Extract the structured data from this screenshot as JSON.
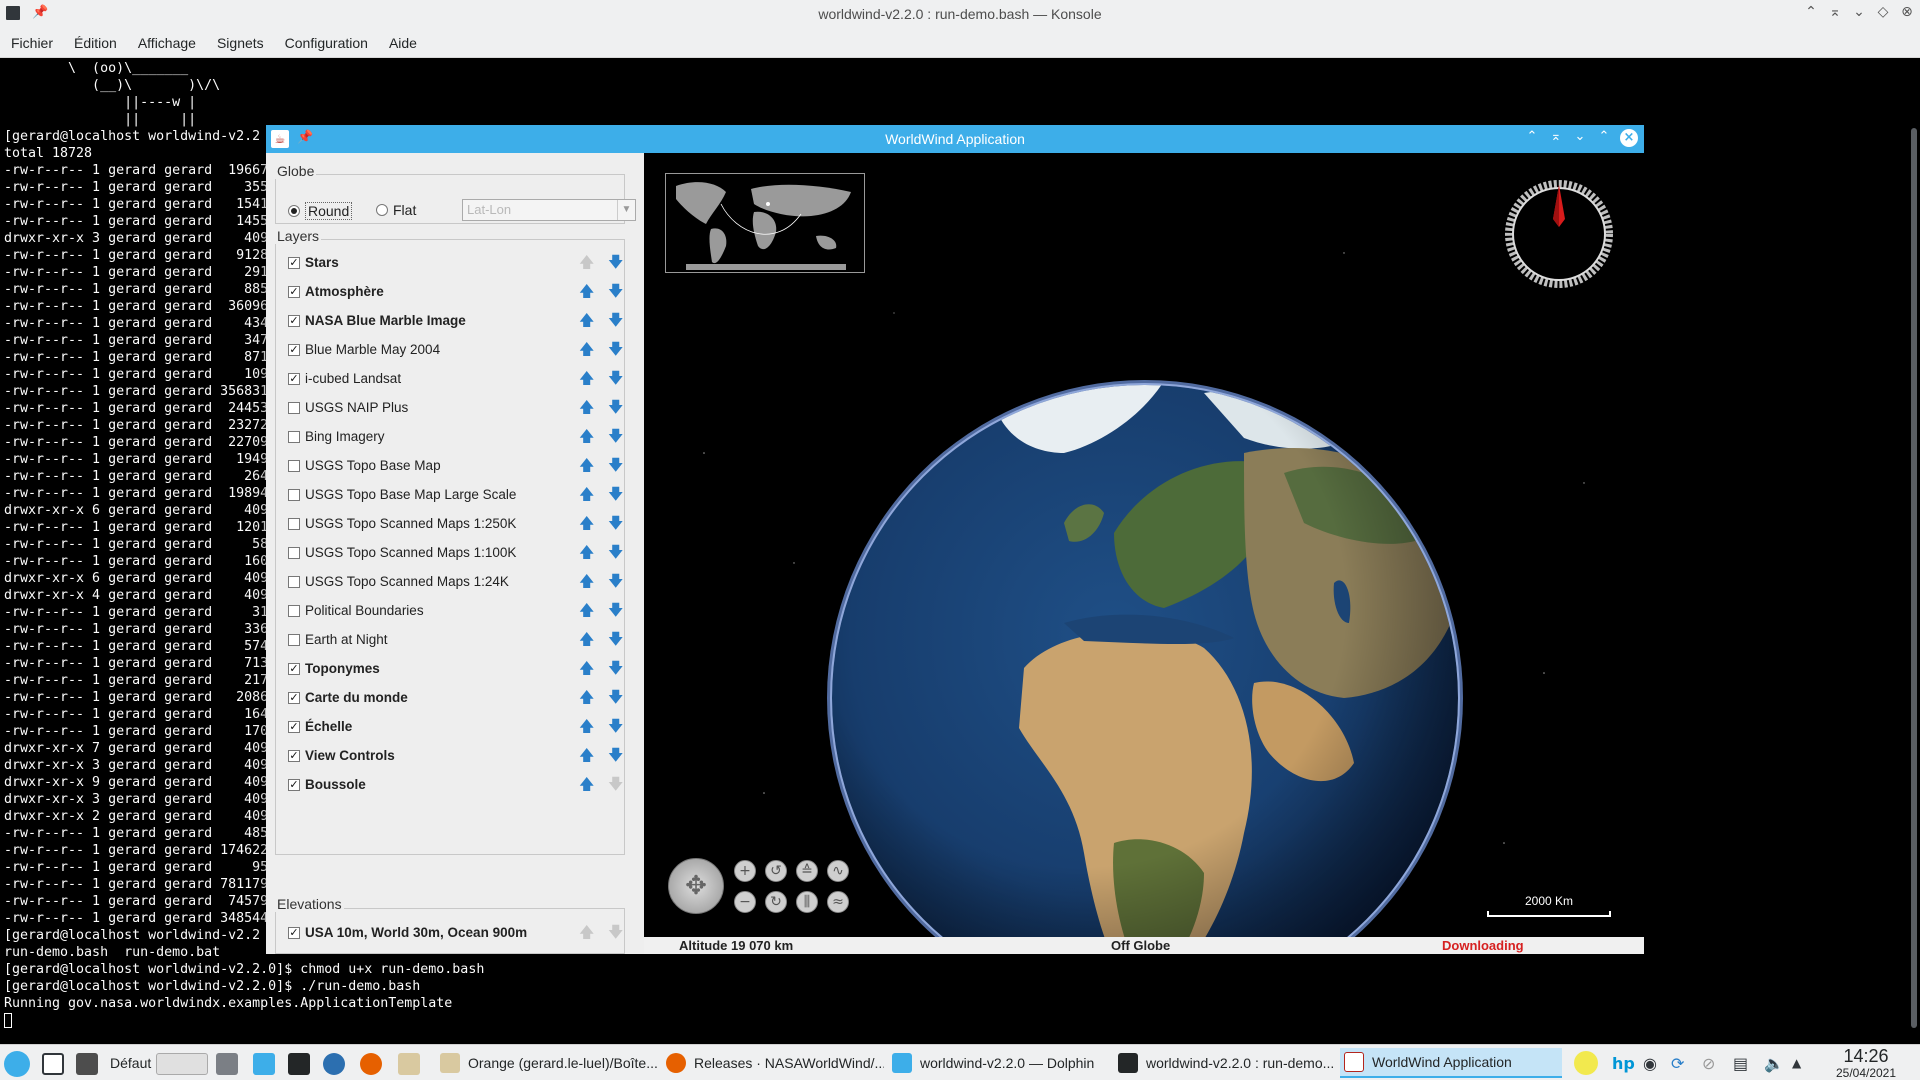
{
  "konsole": {
    "title": "worldwind-v2.2.0 : run-demo.bash — Konsole",
    "menu": [
      "Fichier",
      "Édition",
      "Affichage",
      "Signets",
      "Configuration",
      "Aide"
    ],
    "terminal_lines": [
      "        \\  (oo)\\_______",
      "           (__)\\       )\\/\\",
      "               ||----w |",
      "               ||     ||",
      "[gerard@localhost worldwind-v2.2",
      "total 18728",
      "-rw-r--r-- 1 gerard gerard  19667",
      "-rw-r--r-- 1 gerard gerard    355",
      "-rw-r--r-- 1 gerard gerard   1541",
      "-rw-r--r-- 1 gerard gerard   1455",
      "drwxr-xr-x 3 gerard gerard    409",
      "-rw-r--r-- 1 gerard gerard   9128",
      "-rw-r--r-- 1 gerard gerard    291",
      "-rw-r--r-- 1 gerard gerard    885",
      "-rw-r--r-- 1 gerard gerard  36096",
      "-rw-r--r-- 1 gerard gerard    434",
      "-rw-r--r-- 1 gerard gerard    347",
      "-rw-r--r-- 1 gerard gerard    871",
      "-rw-r--r-- 1 gerard gerard    109",
      "-rw-r--r-- 1 gerard gerard 356831",
      "-rw-r--r-- 1 gerard gerard  24453",
      "-rw-r--r-- 1 gerard gerard  23272",
      "-rw-r--r-- 1 gerard gerard  22709",
      "-rw-r--r-- 1 gerard gerard   1949",
      "-rw-r--r-- 1 gerard gerard    264",
      "-rw-r--r-- 1 gerard gerard  19894",
      "drwxr-xr-x 6 gerard gerard    409",
      "-rw-r--r-- 1 gerard gerard   1201",
      "-rw-r--r-- 1 gerard gerard     58",
      "-rw-r--r-- 1 gerard gerard    160",
      "drwxr-xr-x 6 gerard gerard    409",
      "drwxr-xr-x 4 gerard gerard    409",
      "-rw-r--r-- 1 gerard gerard     31",
      "-rw-r--r-- 1 gerard gerard    336",
      "-rw-r--r-- 1 gerard gerard    574",
      "-rw-r--r-- 1 gerard gerard    713",
      "-rw-r--r-- 1 gerard gerard    217",
      "-rw-r--r-- 1 gerard gerard   2086",
      "-rw-r--r-- 1 gerard gerard    164",
      "-rw-r--r-- 1 gerard gerard    170",
      "drwxr-xr-x 7 gerard gerard    409",
      "drwxr-xr-x 3 gerard gerard    409",
      "drwxr-xr-x 9 gerard gerard    409",
      "drwxr-xr-x 3 gerard gerard    409",
      "drwxr-xr-x 2 gerard gerard    409",
      "-rw-r--r-- 1 gerard gerard    485",
      "-rw-r--r-- 1 gerard gerard 174622",
      "-rw-r--r-- 1 gerard gerard     95",
      "-rw-r--r-- 1 gerard gerard 781179",
      "-rw-r--r-- 1 gerard gerard  74579",
      "-rw-r--r-- 1 gerard gerard 348544",
      "[gerard@localhost worldwind-v2.2",
      "run-demo.bash  run-demo.bat",
      "[gerard@localhost worldwind-v2.2.0]$ chmod u+x run-demo.bash",
      "[gerard@localhost worldwind-v2.2.0]$ ./run-demo.bash",
      "Running gov.nasa.worldwindx.examples.ApplicationTemplate"
    ]
  },
  "worldwind": {
    "title": "WorldWind Application",
    "globe_group": {
      "title": "Globe",
      "round_label": "Round",
      "flat_label": "Flat",
      "selected": "Round",
      "projection_placeholder": "Lat-Lon"
    },
    "layers_group": {
      "title": "Layers",
      "layers": [
        {
          "name": "Stars",
          "checked": true,
          "bold": true
        },
        {
          "name": "Atmosphère",
          "checked": true,
          "bold": true
        },
        {
          "name": "NASA Blue Marble Image",
          "checked": true,
          "bold": true
        },
        {
          "name": "Blue Marble May 2004",
          "checked": true,
          "bold": false
        },
        {
          "name": "i-cubed Landsat",
          "checked": true,
          "bold": false
        },
        {
          "name": "USGS NAIP Plus",
          "checked": false,
          "bold": false
        },
        {
          "name": "Bing Imagery",
          "checked": false,
          "bold": false
        },
        {
          "name": "USGS Topo Base Map",
          "checked": false,
          "bold": false
        },
        {
          "name": "USGS Topo Base Map Large Scale",
          "checked": false,
          "bold": false
        },
        {
          "name": "USGS Topo Scanned Maps 1:250K",
          "checked": false,
          "bold": false
        },
        {
          "name": "USGS Topo Scanned Maps 1:100K",
          "checked": false,
          "bold": false
        },
        {
          "name": "USGS Topo Scanned Maps 1:24K",
          "checked": false,
          "bold": false
        },
        {
          "name": "Political Boundaries",
          "checked": false,
          "bold": false
        },
        {
          "name": "Earth at Night",
          "checked": false,
          "bold": false
        },
        {
          "name": "Toponymes",
          "checked": true,
          "bold": true
        },
        {
          "name": "Carte du monde",
          "checked": true,
          "bold": true
        },
        {
          "name": "Échelle",
          "checked": true,
          "bold": true
        },
        {
          "name": "View Controls",
          "checked": true,
          "bold": true
        },
        {
          "name": "Boussole",
          "checked": true,
          "bold": true
        }
      ]
    },
    "elevations_group": {
      "title": "Elevations",
      "item": {
        "name": "USA 10m, World 30m, Ocean 900m",
        "checked": true
      }
    },
    "scale_label": "2000 Km",
    "status": {
      "altitude": "Altitude  19 070 km",
      "position": "Off Globe",
      "downloading": "Downloading"
    },
    "colors": {
      "accent": "#3daee9",
      "downloading": "#d62020",
      "compass_needle": "#d81b1b"
    }
  },
  "taskbar": {
    "activity_label": "Défaut",
    "tasks": [
      {
        "label": "Orange (gerard.le-luel)/Boîte...",
        "icon": "mail-icon"
      },
      {
        "label": "Releases · NASAWorldWind/...",
        "icon": "firefox-icon"
      },
      {
        "label": "worldwind-v2.2.0 — Dolphin",
        "icon": "folder-icon"
      },
      {
        "label": "worldwind-v2.2.0 : run-demo...",
        "icon": "terminal-icon"
      },
      {
        "label": "WorldWind Application",
        "icon": "java-icon"
      }
    ],
    "time": "14:26",
    "date": "25/04/2021"
  }
}
